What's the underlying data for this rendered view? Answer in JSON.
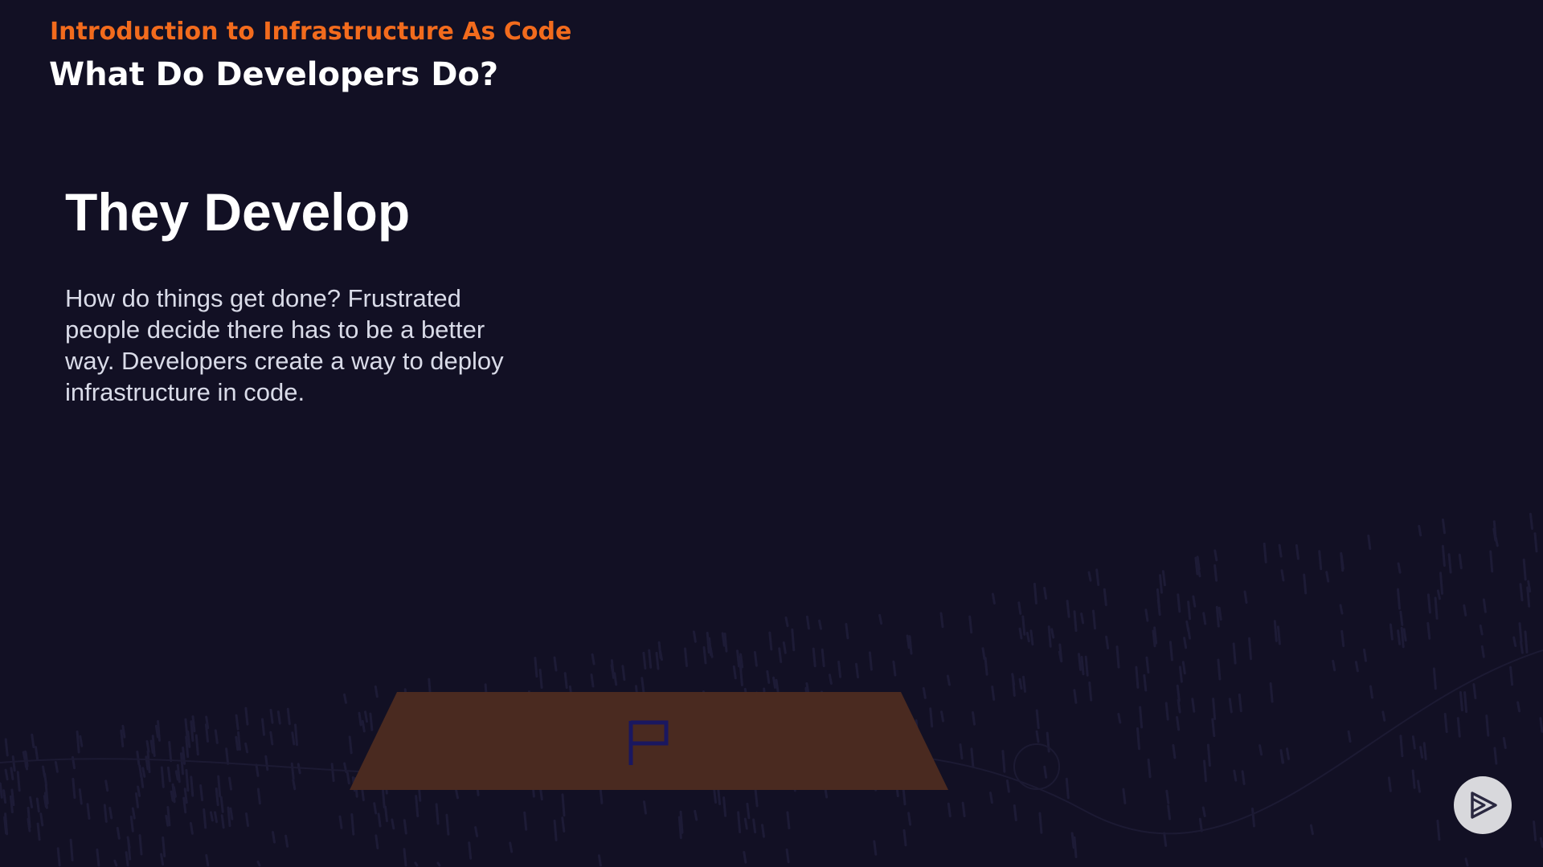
{
  "header": {
    "course_title": "Introduction to Infrastructure As Code",
    "module_title": "What Do Developers Do?"
  },
  "slide": {
    "heading": "They Develop",
    "body": "How do things get done? Frustrated people decide there has to be a better way. Developers create a way to deploy infrastructure in code."
  },
  "icons": {
    "platform_flag": "flag-icon",
    "brand_badge": "play-logo-icon"
  },
  "colors": {
    "background": "#121024",
    "accent": "#f26b1d",
    "platform": "#4a2a20",
    "flag": "#1a1760"
  }
}
